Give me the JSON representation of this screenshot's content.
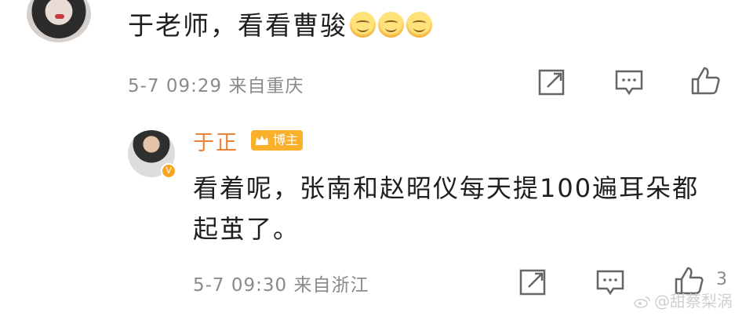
{
  "comment": {
    "text": "于老师，看看曹骏",
    "emoji_icons": [
      "smile-icon",
      "smile-icon",
      "smile-icon"
    ],
    "meta": "5-7 09:29 来自重庆",
    "actions": [
      "share-icon",
      "comment-icon",
      "like-icon"
    ]
  },
  "reply": {
    "author": "于正",
    "badge": "博主",
    "text": "看着呢，张南和赵昭仪每天提100遍耳朵都起茧了。",
    "meta": "5-7 09:30 来自浙江",
    "like_count": "3",
    "actions": [
      "share-icon",
      "comment-icon",
      "like-icon"
    ]
  },
  "watermark": "@甜蔡梨涡",
  "colors": {
    "name": "#e9833a",
    "badge": "#f9b12c",
    "meta": "#8a8a8a"
  }
}
